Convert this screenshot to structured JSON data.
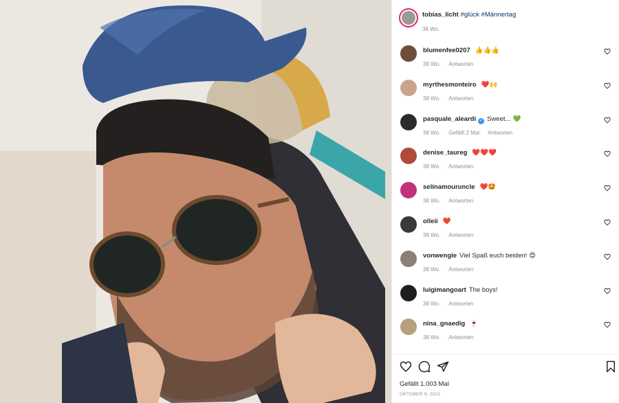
{
  "post": {
    "author": "tobias_licht",
    "caption_tags": "#glück #Männertag",
    "age": "38 Wo."
  },
  "comments": [
    {
      "user": "blumenfee0207",
      "text": "",
      "emoji": "👍👍👍",
      "age": "38 Wo.",
      "likes": "",
      "reply": "Antworten",
      "avatar_color": "#6b4f3a"
    },
    {
      "user": "myrthesmonteiro",
      "text": "",
      "emoji": "❤️🙌",
      "age": "38 Wo.",
      "likes": "",
      "reply": "Antworten",
      "avatar_color": "#c9a58c"
    },
    {
      "user": "pasquale_aleardi",
      "verified": true,
      "text": "Sweet...",
      "emoji": "💚",
      "age": "38 Wo.",
      "likes": "Gefällt 2 Mal",
      "reply": "Antworten",
      "avatar_color": "#2b2b2b"
    },
    {
      "user": "denise_taureg",
      "text": "",
      "emoji": "❤️❤️❤️",
      "age": "38 Wo.",
      "likes": "",
      "reply": "Antworten",
      "avatar_color": "#b04a3a"
    },
    {
      "user": "selinamouruncle",
      "text": "",
      "emoji": "❤️🤩",
      "age": "38 Wo.",
      "likes": "",
      "reply": "Antworten",
      "avatar_color": "#c2327a"
    },
    {
      "user": "olleii",
      "text": "",
      "emoji": "❤️",
      "age": "38 Wo.",
      "likes": "",
      "reply": "Antworten",
      "avatar_color": "#3a3a3a"
    },
    {
      "user": "vonwengie",
      "text": "Viel Spaß euch beiden!",
      "emoji": "😍",
      "age": "38 Wo.",
      "likes": "",
      "reply": "Antworten",
      "avatar_color": "#8a8078"
    },
    {
      "user": "luigimangoart",
      "text": "The boys!",
      "emoji": "",
      "age": "38 Wo.",
      "likes": "",
      "reply": "Antworten",
      "avatar_color": "#1e1e1e"
    },
    {
      "user": "nina_gnaedig",
      "text": "",
      "emoji": "🍷",
      "age": "38 Wo.",
      "likes": "",
      "reply": "Antworten",
      "avatar_color": "#b7a07a"
    }
  ],
  "footer": {
    "likes_text": "Gefällt 1.003 Mal",
    "date_text": "OKTOBER 9, 2021"
  },
  "icons": {
    "like": "heart-outline-icon",
    "comment": "comment-bubble-icon",
    "share": "paper-plane-icon",
    "save": "bookmark-icon",
    "comment_like": "small-heart-icon"
  },
  "colors": {
    "link": "#00376b",
    "muted": "#8e8e8e",
    "text": "#262626",
    "story_ring": "#d62976",
    "verified": "#3897f0"
  }
}
